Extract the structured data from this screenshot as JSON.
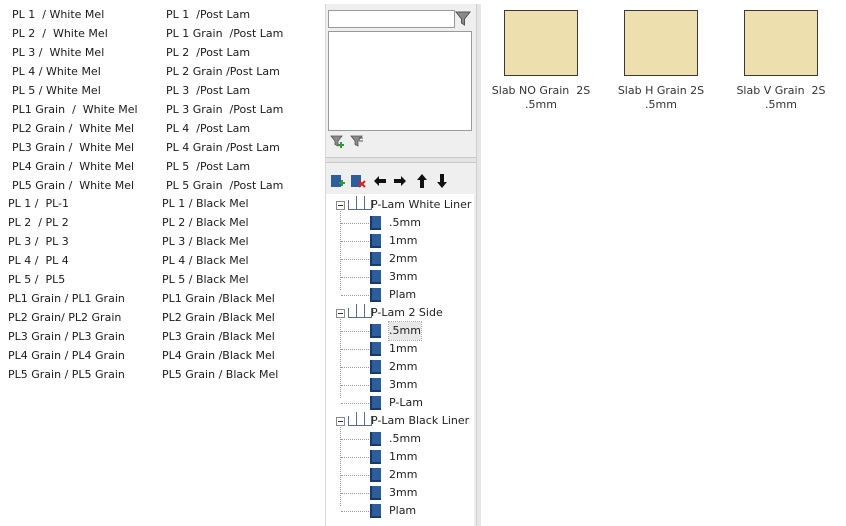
{
  "materials_left": [
    "PL 1  / White Mel",
    "PL 2  /  White Mel",
    "PL 3 /  White Mel",
    "PL 4 / White Mel",
    "PL 5 / White Mel",
    "PL1 Grain  /  White Mel",
    "PL2 Grain /  White Mel",
    "PL3 Grain /  White Mel",
    "PL4 Grain /  White Mel",
    "PL5 Grain /  White Mel",
    "PL 1 /  PL-1",
    "PL 2  / PL 2",
    "PL 3 /  PL 3",
    "PL 4 /  PL 4",
    "PL 5 /  PL5",
    "PL1 Grain / PL1 Grain",
    "PL2 Grain/ PL2 Grain",
    "PL3 Grain / PL3 Grain",
    "PL4 Grain / PL4 Grain",
    "PL5 Grain / PL5 Grain"
  ],
  "materials_right": [
    "PL 1  /Post Lam",
    "PL 1 Grain  /Post Lam",
    "PL 2  /Post Lam",
    "PL 2 Grain /Post Lam",
    "PL 3  /Post Lam",
    "PL 3 Grain  /Post Lam",
    "PL 4  /Post Lam",
    "PL 4 Grain /Post Lam",
    "PL 5  /Post Lam",
    "PL 5 Grain  /Post Lam",
    "PL 1 / Black Mel",
    "PL 2 / Black Mel",
    "PL 3 / Black Mel",
    "PL 4 / Black Mel",
    "PL 5 / Black Mel",
    "PL1 Grain /Black Mel",
    "PL2 Grain /Black Mel",
    "PL3 Grain /Black Mel",
    "PL4 Grain /Black Mel",
    "PL5 Grain / Black Mel"
  ],
  "search": {
    "value": "",
    "placeholder": ""
  },
  "icons": {
    "filter": "funnel-icon",
    "filter_add": "funnel-add-icon",
    "filter_remove": "funnel-remove-icon",
    "add": "add-item-icon",
    "delete": "delete-item-icon",
    "left": "arrow-left-icon",
    "right": "arrow-right-icon",
    "up": "arrow-up-icon",
    "down": "arrow-down-icon"
  },
  "tree": [
    {
      "label": "P-Lam White Liner",
      "children": [
        ".5mm",
        "1mm",
        "2mm",
        "3mm",
        "Plam"
      ]
    },
    {
      "label": "P-Lam 2 Side",
      "children": [
        ".5mm",
        "1mm",
        "2mm",
        "3mm",
        "P-Lam"
      ],
      "selected_child": 0
    },
    {
      "label": "P-Lam Black Liner",
      "children": [
        ".5mm",
        "1mm",
        "2mm",
        "3mm",
        "Plam"
      ]
    }
  ],
  "tiles": [
    {
      "caption": "Slab NO Grain  2S\n.5mm"
    },
    {
      "caption": "Slab H Grain 2S  .5mm"
    },
    {
      "caption": "Slab V Grain  2S  .5mm"
    }
  ],
  "colors": {
    "swatch": "#ede0ae",
    "tree_icon": "#2d5d9a",
    "panel_bg": "#efefef"
  }
}
